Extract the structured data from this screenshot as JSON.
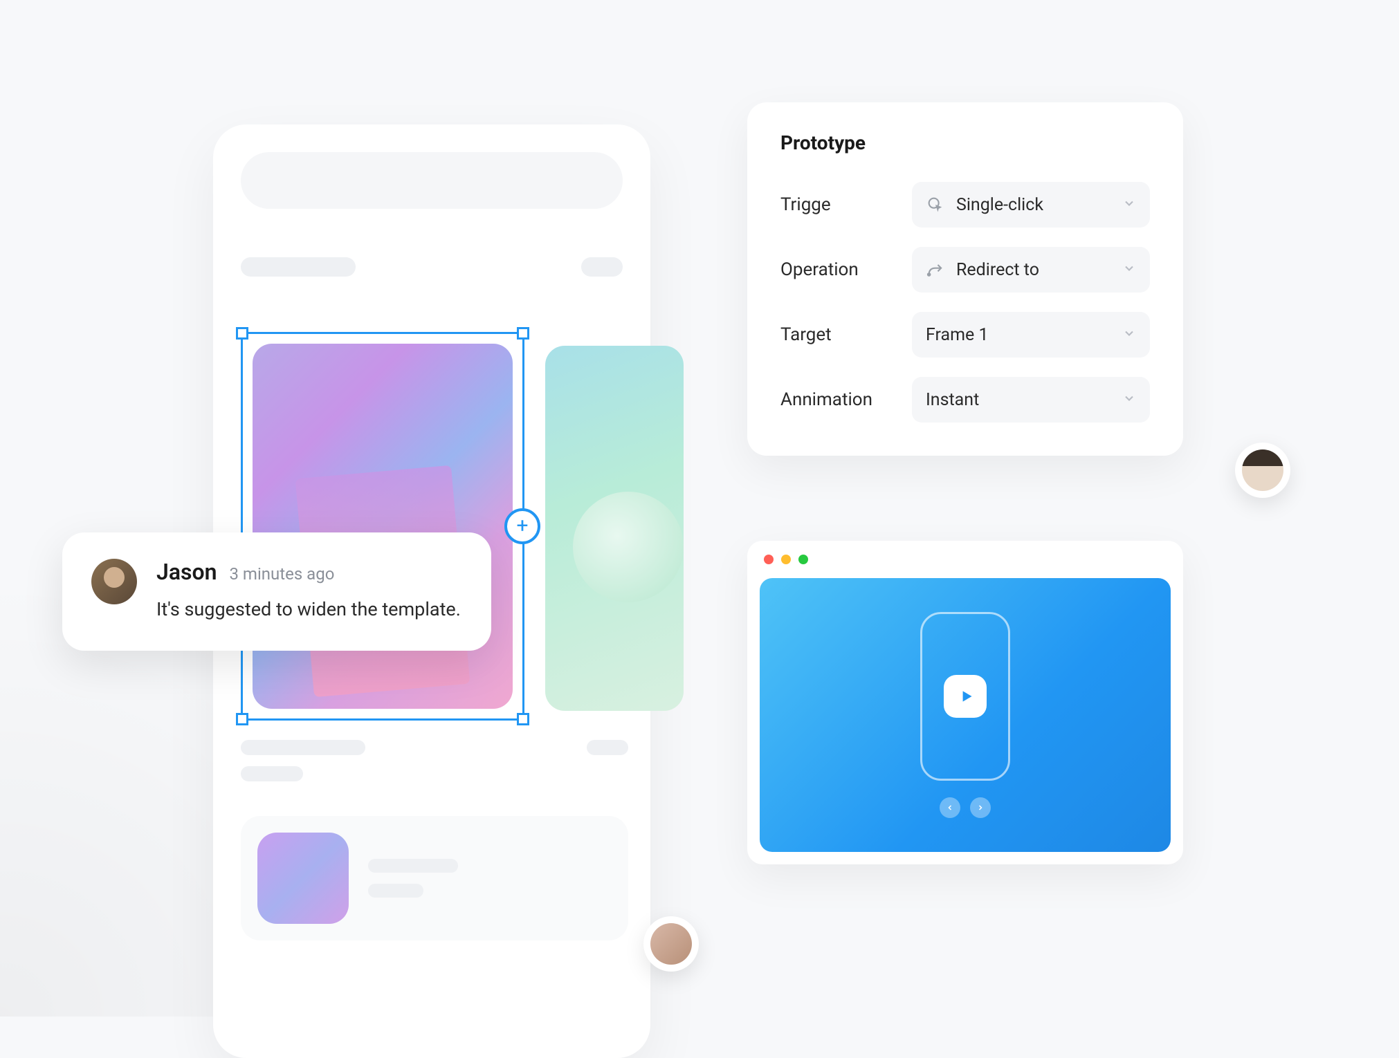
{
  "comment": {
    "author": "Jason",
    "time": "3 minutes ago",
    "text": "It's suggested to widen the template."
  },
  "prototype": {
    "title": "Prototype",
    "rows": {
      "trigger": {
        "label": "Trigge",
        "value": "Single-click"
      },
      "operation": {
        "label": "Operation",
        "value": "Redirect to"
      },
      "target": {
        "label": "Target",
        "value": "Frame 1"
      },
      "animation": {
        "label": "Annimation",
        "value": "Instant"
      }
    }
  }
}
